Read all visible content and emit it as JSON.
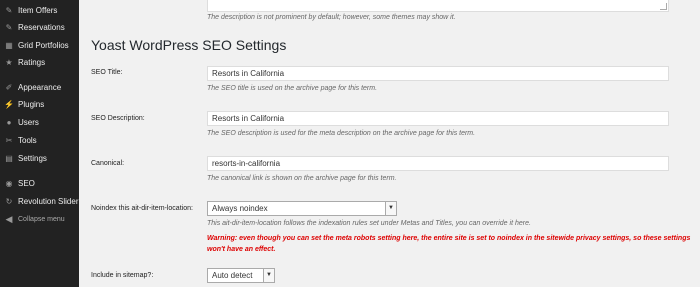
{
  "sidebar": {
    "items": [
      {
        "icon": "pushpin-icon",
        "glyph": "✎",
        "label": "Item Offers"
      },
      {
        "icon": "pushpin-icon",
        "glyph": "✎",
        "label": "Reservations"
      },
      {
        "icon": "grid-icon",
        "glyph": "▦",
        "label": "Grid Portfolios"
      },
      {
        "icon": "star-icon",
        "glyph": "★",
        "label": "Ratings"
      },
      {
        "icon": "paintbrush-icon",
        "glyph": "✐",
        "label": "Appearance"
      },
      {
        "icon": "plugin-icon",
        "glyph": "⚡",
        "label": "Plugins"
      },
      {
        "icon": "users-icon",
        "glyph": "●",
        "label": "Users"
      },
      {
        "icon": "wrench-icon",
        "glyph": "✂",
        "label": "Tools"
      },
      {
        "icon": "settings-icon",
        "glyph": "▤",
        "label": "Settings"
      },
      {
        "icon": "seo-icon",
        "glyph": "◉",
        "label": "SEO"
      },
      {
        "icon": "refresh-icon",
        "glyph": "↻",
        "label": "Revolution Slider"
      },
      {
        "icon": "collapse-icon",
        "glyph": "◀",
        "label": "Collapse menu"
      }
    ]
  },
  "main": {
    "description_note": "The description is not prominent by default; however, some themes may show it.",
    "section_title": "Yoast WordPress SEO Settings",
    "seo_title": {
      "label": "SEO Title:",
      "value": "Resorts in California",
      "help": "The SEO title is used on the archive page for this term."
    },
    "seo_description": {
      "label": "SEO Description:",
      "value": "Resorts in California",
      "help": "The SEO description is used for the meta description on the archive page for this term."
    },
    "canonical": {
      "label": "Canonical:",
      "value": "resorts-in-california",
      "help": "The canonical link is shown on the archive page for this term."
    },
    "noindex": {
      "label": "Noindex this ait-dir-item-location:",
      "value": "Always noindex",
      "help": "This ait-dir-item-location follows the indexation rules set under Metas and Titles, you can override it here.",
      "warning": "Warning: even though you can set the meta robots setting here, the entire site is set to noindex in the sitewide privacy settings, so these settings won't have an effect."
    },
    "sitemap": {
      "label": "Include in sitemap?:",
      "value": "Auto detect"
    }
  }
}
